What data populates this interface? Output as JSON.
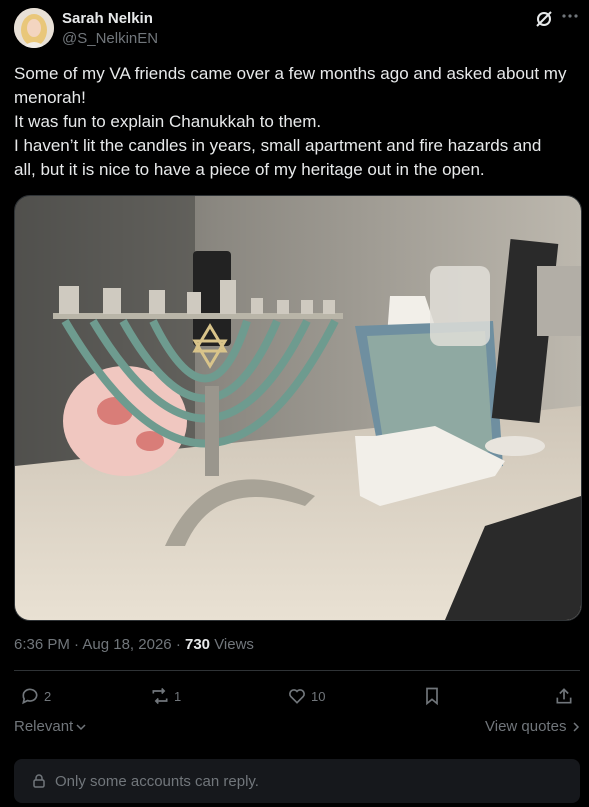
{
  "post": {
    "author_name": "Sarah Nelkin",
    "author_handle": "@S_NelkinEN",
    "text_lines": [
      "Some of my VA friends came over a few months ago and asked about my",
      "menorah!",
      "It was fun to explain Chanukkah to them.",
      "I haven’t lit the candles in years, small apartment and fire hazards and",
      "all, but it is nice to have a piece of my heritage out in the open."
    ],
    "time": "6:36 PM",
    "date": "Aug 18, 2026",
    "separator": "·",
    "views_count": "730",
    "views_label": "Views"
  },
  "actions": {
    "replies": "2",
    "reposts": "1",
    "likes": "10"
  },
  "replies_section": {
    "sort_label": "Relevant",
    "view_quotes_label": "View quotes"
  },
  "reply_restriction": {
    "text": "Only some accounts can reply."
  },
  "icons": [
    "grok-icon",
    "more-icon",
    "reply-icon",
    "repost-icon",
    "like-icon",
    "bookmark-icon",
    "share-icon",
    "chevron-down-icon",
    "chevron-right-icon",
    "lock-icon"
  ],
  "colors": {
    "background": "#000000",
    "primary_text": "#e7e9ea",
    "secondary_text": "#71767b",
    "divider": "#2f3336",
    "reply_box": "#16181c"
  }
}
